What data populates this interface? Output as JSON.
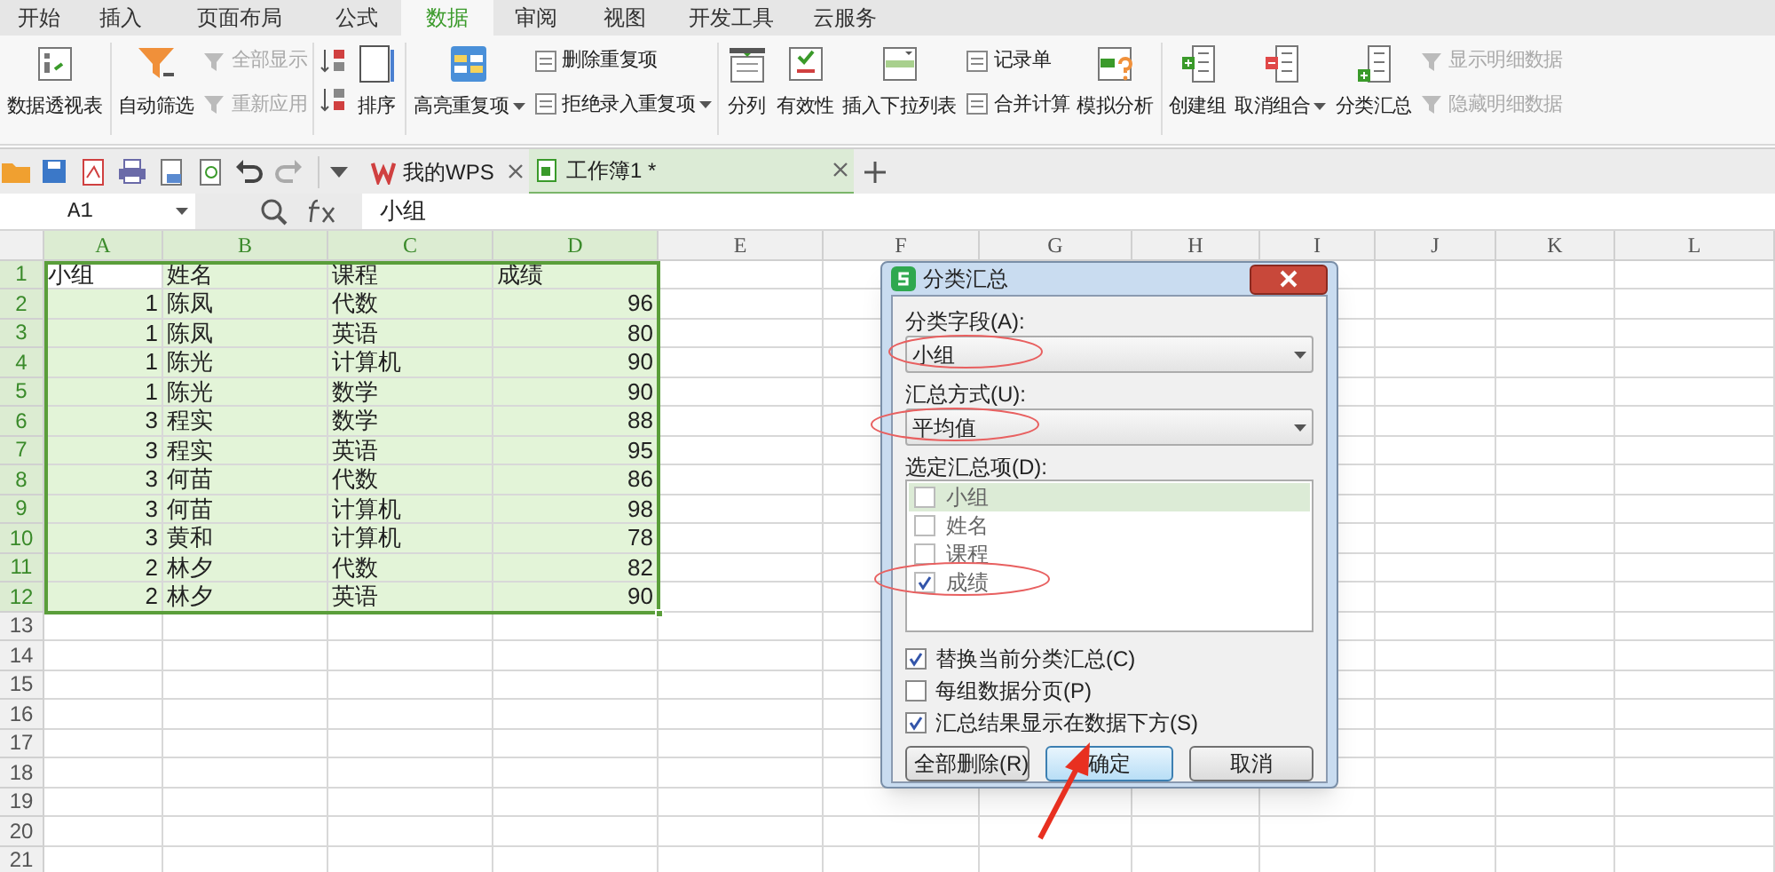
{
  "menu_tabs": [
    {
      "label": "开始",
      "selected": false
    },
    {
      "label": "插入",
      "selected": false
    },
    {
      "label": "页面布局",
      "selected": false
    },
    {
      "label": "公式",
      "selected": false
    },
    {
      "label": "数据",
      "selected": true
    },
    {
      "label": "审阅",
      "selected": false
    },
    {
      "label": "视图",
      "selected": false
    },
    {
      "label": "开发工具",
      "selected": false
    },
    {
      "label": "云服务",
      "selected": false
    }
  ],
  "ribbon": {
    "groups": [
      {
        "items": [
          {
            "kind": "large",
            "label": "数据透视表",
            "dropdown": false
          }
        ]
      },
      {
        "items": [
          {
            "kind": "large",
            "label": "自动筛选",
            "dropdown": false
          },
          {
            "kind": "stack",
            "entries": [
              {
                "label": "全部显示",
                "disabled": true,
                "dropdown": false
              },
              {
                "label": "重新应用",
                "disabled": true,
                "dropdown": false
              }
            ]
          }
        ]
      },
      {
        "items": [
          {
            "kind": "sort"
          },
          {
            "kind": "large",
            "label": "排序",
            "dropdown": false
          }
        ]
      },
      {
        "items": [
          {
            "kind": "large",
            "label": "高亮重复项",
            "dropdown": true
          },
          {
            "kind": "stack",
            "entries": [
              {
                "label": "删除重复项",
                "disabled": false,
                "dropdown": false
              },
              {
                "label": "拒绝录入重复项",
                "disabled": false,
                "dropdown": true
              }
            ]
          }
        ]
      },
      {
        "items": [
          {
            "kind": "large",
            "label": "分列",
            "dropdown": false
          },
          {
            "kind": "large",
            "label": "有效性",
            "dropdown": false
          },
          {
            "kind": "large",
            "label": "插入下拉列表",
            "dropdown": false
          },
          {
            "kind": "stack",
            "entries": [
              {
                "label": "记录单",
                "disabled": false,
                "dropdown": false
              },
              {
                "label": "合并计算",
                "disabled": false,
                "dropdown": false
              }
            ]
          },
          {
            "kind": "large",
            "label": "模拟分析",
            "dropdown": false
          }
        ]
      },
      {
        "items": [
          {
            "kind": "large",
            "label": "创建组",
            "dropdown": false
          },
          {
            "kind": "large",
            "label": "取消组合",
            "dropdown": true
          },
          {
            "kind": "large",
            "label": "分类汇总",
            "dropdown": false
          },
          {
            "kind": "stack",
            "entries": [
              {
                "label": "显示明细数据",
                "disabled": true,
                "dropdown": false
              },
              {
                "label": "隐藏明细数据",
                "disabled": true,
                "dropdown": false
              }
            ]
          }
        ]
      }
    ]
  },
  "document_tabs": [
    {
      "label": "我的WPS",
      "selected": false
    },
    {
      "label": "工作簿1 *",
      "selected": true
    }
  ],
  "formula_bar": {
    "name_box": "A1",
    "formula": "小组"
  },
  "sheet": {
    "columns": [
      {
        "label": "A",
        "selected": true
      },
      {
        "label": "B",
        "selected": true
      },
      {
        "label": "C",
        "selected": true
      },
      {
        "label": "D",
        "selected": true
      },
      {
        "label": "E",
        "selected": false
      },
      {
        "label": "F",
        "selected": false
      },
      {
        "label": "G",
        "selected": false
      },
      {
        "label": "H",
        "selected": false
      },
      {
        "label": "I",
        "selected": false
      },
      {
        "label": "J",
        "selected": false
      },
      {
        "label": "K",
        "selected": false
      },
      {
        "label": "L",
        "selected": false
      }
    ],
    "rows": [
      {
        "number": "1",
        "selected": true,
        "cells": [
          "小组",
          "姓名",
          "课程",
          "成绩"
        ]
      },
      {
        "number": "2",
        "selected": true,
        "cells": [
          "1",
          "陈凤",
          "代数",
          "96"
        ]
      },
      {
        "number": "3",
        "selected": true,
        "cells": [
          "1",
          "陈凤",
          "英语",
          "80"
        ]
      },
      {
        "number": "4",
        "selected": true,
        "cells": [
          "1",
          "陈光",
          "计算机",
          "90"
        ]
      },
      {
        "number": "5",
        "selected": true,
        "cells": [
          "1",
          "陈光",
          "数学",
          "90"
        ]
      },
      {
        "number": "6",
        "selected": true,
        "cells": [
          "3",
          "程实",
          "数学",
          "88"
        ]
      },
      {
        "number": "7",
        "selected": true,
        "cells": [
          "3",
          "程实",
          "英语",
          "95"
        ]
      },
      {
        "number": "8",
        "selected": true,
        "cells": [
          "3",
          "何苗",
          "代数",
          "86"
        ]
      },
      {
        "number": "9",
        "selected": true,
        "cells": [
          "3",
          "何苗",
          "计算机",
          "98"
        ]
      },
      {
        "number": "10",
        "selected": true,
        "cells": [
          "3",
          "黄和",
          "计算机",
          "78"
        ]
      },
      {
        "number": "11",
        "selected": true,
        "cells": [
          "2",
          "林夕",
          "代数",
          "82"
        ]
      },
      {
        "number": "12",
        "selected": true,
        "cells": [
          "2",
          "林夕",
          "英语",
          "90"
        ]
      },
      {
        "number": "13",
        "selected": false,
        "cells": []
      },
      {
        "number": "14",
        "selected": false,
        "cells": []
      },
      {
        "number": "15",
        "selected": false,
        "cells": []
      },
      {
        "number": "16",
        "selected": false,
        "cells": []
      },
      {
        "number": "17",
        "selected": false,
        "cells": []
      },
      {
        "number": "18",
        "selected": false,
        "cells": []
      },
      {
        "number": "19",
        "selected": false,
        "cells": []
      },
      {
        "number": "20",
        "selected": false,
        "cells": []
      },
      {
        "number": "21",
        "selected": false,
        "cells": []
      }
    ]
  },
  "dialog": {
    "title": "分类汇总",
    "group_field": {
      "label": "分类字段(A):",
      "value": "小组"
    },
    "summary_function": {
      "label": "汇总方式(U):",
      "value": "平均值"
    },
    "summary_items": {
      "label": "选定汇总项(D):",
      "items": [
        {
          "label": "小组",
          "checked": false,
          "selected": true
        },
        {
          "label": "姓名",
          "checked": false,
          "selected": false
        },
        {
          "label": "课程",
          "checked": false,
          "selected": false
        },
        {
          "label": "成绩",
          "checked": true,
          "selected": false
        }
      ]
    },
    "options": [
      {
        "label": "替换当前分类汇总(C)",
        "checked": true
      },
      {
        "label": "每组数据分页(P)",
        "checked": false
      },
      {
        "label": "汇总结果显示在数据下方(S)",
        "checked": true
      }
    ],
    "buttons": [
      {
        "label": "全部删除(R)",
        "selected": false
      },
      {
        "label": "确定",
        "selected": true
      },
      {
        "label": "取消",
        "selected": false
      }
    ]
  }
}
